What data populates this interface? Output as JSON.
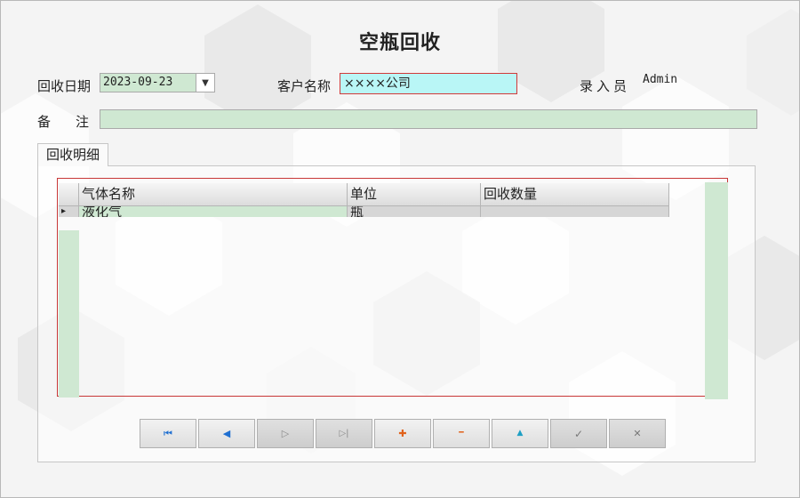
{
  "window": {
    "title": "空瓶回收"
  },
  "form": {
    "date_label": "回收日期",
    "date_value": "2023-09-23",
    "customer_label": "客户名称",
    "customer_value": "××××公司",
    "entry_label": "录入员",
    "entry_value": "Admin",
    "remark_label": "备注",
    "remark_value": ""
  },
  "tabs": [
    {
      "label": "回收明细",
      "selected": true
    }
  ],
  "grid": {
    "columns": [
      "气体名称",
      "单位",
      "回收数量"
    ],
    "rows": [
      {
        "indicator": "▸",
        "gas_name": "液化气",
        "unit": "瓶",
        "quantity": ""
      }
    ]
  },
  "navigator": {
    "buttons": [
      {
        "icon": "first-record-icon",
        "glyph": "⏮",
        "color": "#1f6fd1",
        "enabled": true
      },
      {
        "icon": "prior-record-icon",
        "glyph": "◀",
        "color": "#1f6fd1",
        "enabled": true
      },
      {
        "icon": "next-record-icon",
        "glyph": "▷",
        "color": "#8a8a8a",
        "enabled": false
      },
      {
        "icon": "last-record-icon",
        "glyph": "▷|",
        "color": "#8a8a8a",
        "enabled": false
      },
      {
        "icon": "insert-icon",
        "glyph": "✚",
        "color": "#e0621b",
        "enabled": true
      },
      {
        "icon": "delete-icon",
        "glyph": "━",
        "color": "#e0621b",
        "enabled": true
      },
      {
        "icon": "edit-icon",
        "glyph": "▲",
        "color": "#1e9fc4",
        "enabled": true
      },
      {
        "icon": "post-icon",
        "glyph": "✓",
        "color": "#777777",
        "enabled": false
      },
      {
        "icon": "cancel-icon",
        "glyph": "✕",
        "color": "#777777",
        "enabled": false
      }
    ]
  },
  "colors": {
    "accent_border": "#c83737",
    "field_green": "#cfe8d2",
    "field_cyan": "#b9f6f6"
  }
}
